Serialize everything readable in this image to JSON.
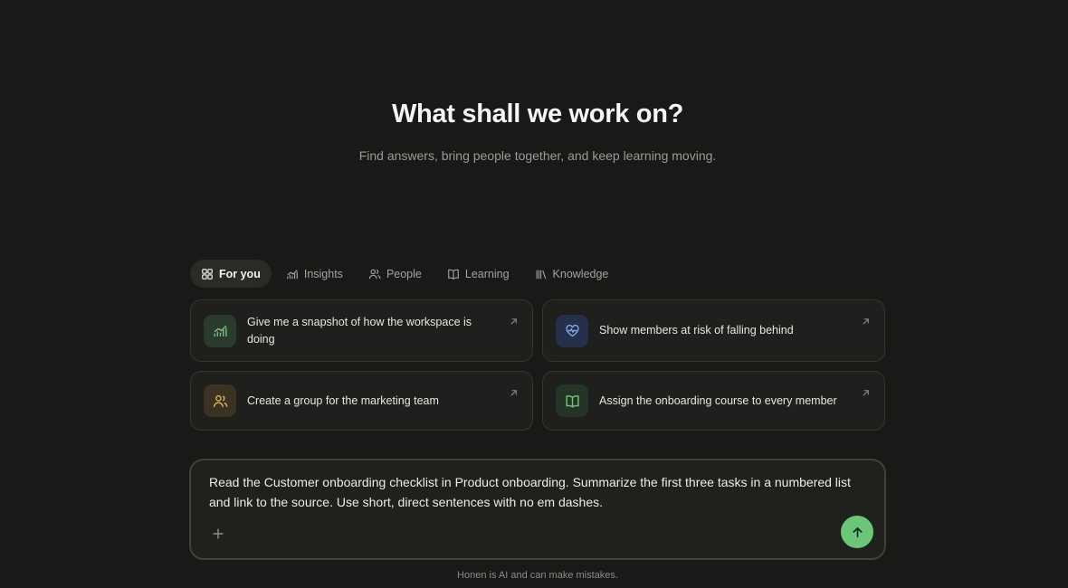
{
  "hero": {
    "title": "What shall we work on?",
    "subtitle": "Find answers, bring people together, and keep learning moving."
  },
  "tabs": [
    {
      "label": "For you",
      "icon": "grid-icon",
      "active": true
    },
    {
      "label": "Insights",
      "icon": "chart-icon",
      "active": false
    },
    {
      "label": "People",
      "icon": "people-icon",
      "active": false
    },
    {
      "label": "Learning",
      "icon": "book-icon",
      "active": false
    },
    {
      "label": "Knowledge",
      "icon": "library-icon",
      "active": false
    }
  ],
  "cards": [
    {
      "text": "Give me a snapshot of how the workspace is doing",
      "icon": "chart-icon",
      "color": "#7bc47f"
    },
    {
      "text": "Show members at risk of falling behind",
      "icon": "heart-pulse-icon",
      "color": "#7fa8ee"
    },
    {
      "text": "Create a group for the marketing team",
      "icon": "people-icon",
      "color": "#e0b45a"
    },
    {
      "text": "Assign the onboarding course to every member",
      "icon": "book-icon",
      "color": "#7bc47f"
    }
  ],
  "composer": {
    "text": "Read the Customer onboarding checklist in Product onboarding. Summarize the first three tasks in a numbered list and link to the source. Use short, direct sentences with no em dashes."
  },
  "footer": {
    "disclaimer": "Honen is AI and can make mistakes."
  },
  "colors": {
    "background": "#191918",
    "accent": "#6cc67a"
  }
}
